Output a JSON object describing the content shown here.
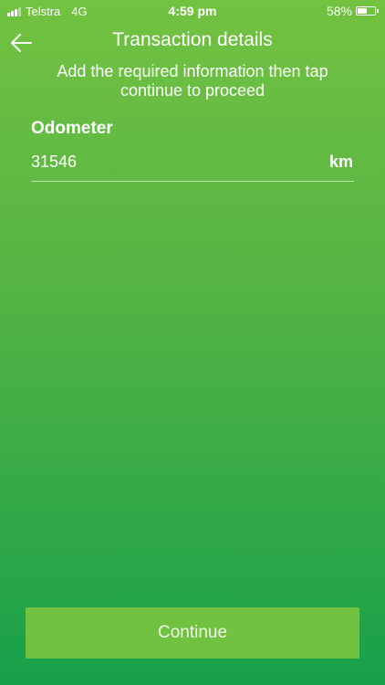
{
  "status_bar": {
    "carrier": "Telstra",
    "network": "4G",
    "time": "4:59 pm",
    "battery_text": "58%",
    "battery_level": 0.58
  },
  "header": {
    "title": "Transaction details",
    "back_icon": "arrow-left-icon"
  },
  "instructions": "Add the required information then tap continue to proceed",
  "odometer": {
    "label": "Odometer",
    "value": "31546",
    "unit": "km"
  },
  "continue_button": {
    "label": "Continue"
  },
  "colors": {
    "background_top": "#73c241",
    "background_bottom": "#17a04a",
    "button": "#72c241",
    "text": "#ffffff"
  }
}
